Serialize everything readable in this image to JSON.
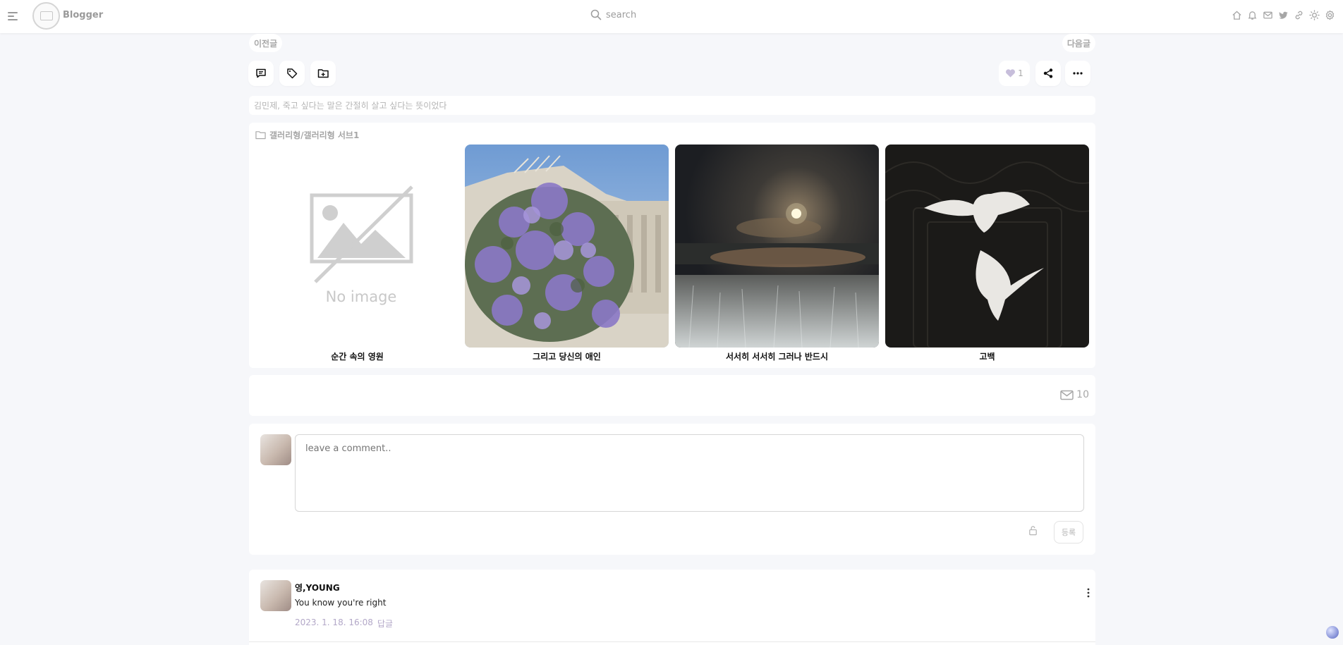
{
  "topbar": {
    "brand": "Blogger",
    "search_placeholder": "search",
    "icons": [
      "home-icon",
      "bell-icon",
      "mail-icon",
      "twitter-icon",
      "link-icon",
      "sun-icon",
      "gear-icon"
    ]
  },
  "nav": {
    "prev": "이전글",
    "next": "다음글"
  },
  "actions": {
    "like_count": "1"
  },
  "tagline": "김민제, 죽고 싶다는 말은 간절히 살고 싶다는 뜻이었다",
  "gallery": {
    "category": "갤러리형/갤러리형 서브1",
    "no_image_text": "No image",
    "items": [
      {
        "caption": "순간 속의 영원"
      },
      {
        "caption": "그리고 당신의 애인"
      },
      {
        "caption": "서서히 서서히 그러나 반드시"
      },
      {
        "caption": "고백"
      }
    ]
  },
  "mail": {
    "count": "10"
  },
  "comment_form": {
    "placeholder": "leave a comment..",
    "submit_label": "등록"
  },
  "comments": [
    {
      "author": "영,YOUNG",
      "text": "You know you're right",
      "date": "2023. 1. 18. 16:08",
      "reply_label": "답글"
    }
  ],
  "colors": {
    "background": "#f6f7fa",
    "accent": "#b3a8c8",
    "card": "#ffffff"
  }
}
